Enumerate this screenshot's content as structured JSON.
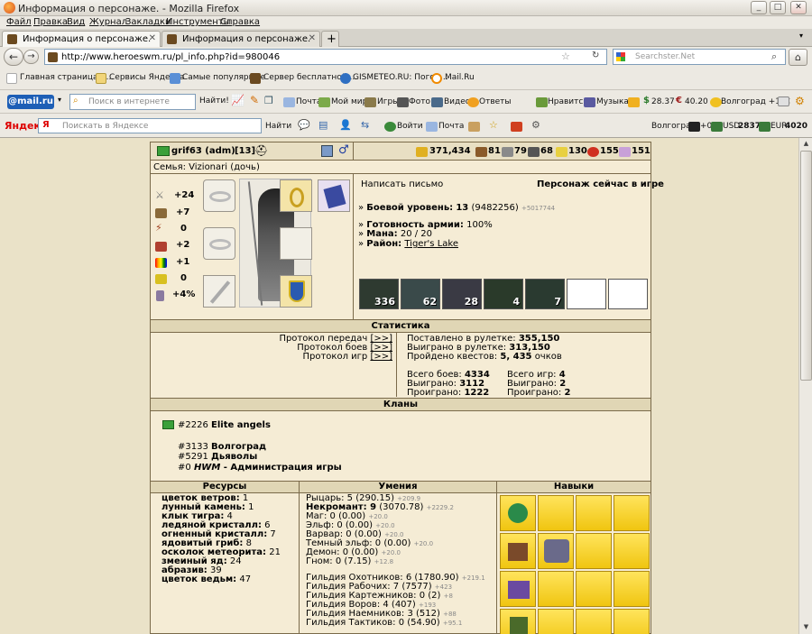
{
  "window": {
    "title": "Информация о персонаже. - Mozilla Firefox"
  },
  "menu": [
    "Файл",
    "Правка",
    "Вид",
    "Журнал",
    "Закладки",
    "Инструменты",
    "Справка"
  ],
  "tabs": [
    {
      "label": "Информация о персонаже."
    },
    {
      "label": "Информация о персонаже."
    }
  ],
  "nav": {
    "url": "http://www.heroeswm.ru/pl_info.php?id=980046",
    "search_placeholder": "Searchster.Net"
  },
  "bookmarks": [
    "Главная страница Я...",
    "Сервисы Яндекса",
    "Самые популярные",
    "Сервер бесплатной ...",
    "GISMETEO.RU: Погод...",
    "Mail.Ru"
  ],
  "mailbar": {
    "logo": "@mail.ru",
    "search_placeholder": "Поиск в интернете",
    "find": "Найти!",
    "items": [
      "Почта",
      "Мой мир",
      "Игры",
      "Фото",
      "Видео",
      "Ответы"
    ],
    "right": [
      "Нравится",
      "Музыка",
      "28.37",
      "40.20",
      "Волгоград +1°C"
    ]
  },
  "yabar": {
    "logo": "Яндекс",
    "search_placeholder": "Поискать в Яндексе",
    "find": "Найти",
    "login": "Войти",
    "mail": "Почта",
    "city": "Волгоград",
    "traffic": "+0",
    "usd_label": "USD",
    "usd": "2837",
    "eur_label": "EUR",
    "eur": "4020"
  },
  "player": {
    "name": "grif63 (adm)",
    "level": "[13]",
    "family": "Семья: Vizionari (дочь)",
    "resources_top": [
      "371,434",
      "81",
      "79",
      "68",
      "130",
      "155",
      "151"
    ]
  },
  "stats": [
    "+24",
    "+7",
    "0",
    "+2",
    "+1",
    "0",
    "+4%"
  ],
  "info": {
    "write_letter": "Написать письмо",
    "online": "Персонаж сейчас в игре",
    "combat_label": "Боевой уровень:",
    "combat_value": "13",
    "combat_exp": "(9482256)",
    "combat_delta": "+5017744",
    "army_label": "Готовность армии:",
    "army_value": "100%",
    "mana_label": "Мана:",
    "mana_value": "20 / 20",
    "district_label": "Район:",
    "district_value": "Tiger's Lake"
  },
  "army": [
    "336",
    "62",
    "28",
    "4",
    "7"
  ],
  "statistics": {
    "header": "Статистика",
    "protocols": [
      "Протокол передач",
      "Протокол боев",
      "Протокол игр"
    ],
    "protocol_link": "[>>]",
    "roulette_bet_label": "Поставлено в рулетке:",
    "roulette_bet": "355,150",
    "roulette_won_label": "Выиграно в рулетке:",
    "roulette_won": "313,150",
    "quests_label": "Пройдено квестов:",
    "quests": "5, 435",
    "quests_unit": "очков",
    "battles_total_label": "Всего боев:",
    "battles_total": "4334",
    "battles_won_label": "Выиграно:",
    "battles_won": "3112",
    "battles_lost_label": "Проиграно:",
    "battles_lost": "1222",
    "games_total_label": "Всего игр:",
    "games_total": "4",
    "games_won_label": "Выиграно:",
    "games_won": "2",
    "games_lost_label": "Проиграно:",
    "games_lost": "2"
  },
  "clans": {
    "header": "Кланы",
    "list": [
      {
        "id": "#2226",
        "name": "Elite angels"
      },
      {
        "id": "#3133",
        "name": "Волгоград"
      },
      {
        "id": "#5291",
        "name": "Дьяволы"
      },
      {
        "id": "#0",
        "prefix": "HWM",
        "name": "- Администрация игры"
      }
    ]
  },
  "resources": {
    "header": "Ресурсы",
    "items": [
      {
        "name": "цветок ветров:",
        "value": "1"
      },
      {
        "name": "лунный камень:",
        "value": "1"
      },
      {
        "name": "клык тигра:",
        "value": "4"
      },
      {
        "name": "ледяной кристалл:",
        "value": "6"
      },
      {
        "name": "огненный кристалл:",
        "value": "7"
      },
      {
        "name": "ядовитый гриб:",
        "value": "8"
      },
      {
        "name": "осколок метеорита:",
        "value": "21"
      },
      {
        "name": "змеиный яд:",
        "value": "24"
      },
      {
        "name": "абразив:",
        "value": "39"
      },
      {
        "name": "цветок ведьм:",
        "value": "47"
      }
    ]
  },
  "skills": {
    "header": "Умения",
    "items": [
      {
        "text": "Рыцарь: 5 (290.15)",
        "delta": "+209.9",
        "bold": false
      },
      {
        "text": "Некромант: 9",
        "extra": "(3070.78)",
        "delta": "+2229.2",
        "bold": true
      },
      {
        "text": "Маг: 0 (0.00)",
        "delta": "+20.0",
        "bold": false
      },
      {
        "text": "Эльф: 0 (0.00)",
        "delta": "+20.0",
        "bold": false
      },
      {
        "text": "Варвар: 0 (0.00)",
        "delta": "+20.0",
        "bold": false
      },
      {
        "text": "Темный эльф: 0 (0.00)",
        "delta": "+20.0",
        "bold": false
      },
      {
        "text": "Демон: 0 (0.00)",
        "delta": "+20.0",
        "bold": false
      },
      {
        "text": "Гном: 0 (7.15)",
        "delta": "+12.8",
        "bold": false
      }
    ],
    "guilds": [
      {
        "text": "Гильдия Охотников: 6 (1780.90)",
        "delta": "+219.1"
      },
      {
        "text": "Гильдия Рабочих: 7 (7577)",
        "delta": "+423"
      },
      {
        "text": "Гильдия Картежников: 0 (2)",
        "delta": "+8"
      },
      {
        "text": "Гильдия Воров: 4 (407)",
        "delta": "+193"
      },
      {
        "text": "Гильдия Наемников: 3 (512)",
        "delta": "+88"
      },
      {
        "text": "Гильдия Тактиков: 0 (54.90)",
        "delta": "+95.1"
      }
    ]
  },
  "talents": {
    "header": "Навыки"
  }
}
